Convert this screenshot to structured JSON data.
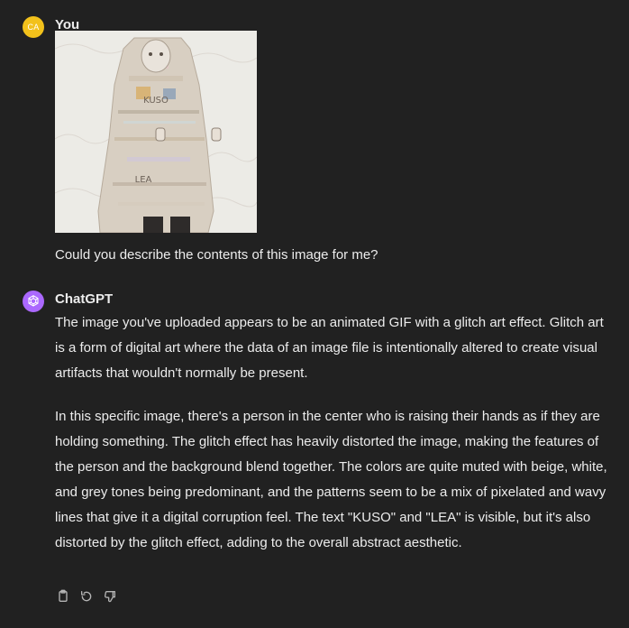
{
  "user_message": {
    "avatar_initials": "CA",
    "author": "You",
    "image_alt": "glitch art image of a person with raised hands",
    "text": "Could you describe the contents of this image for me?"
  },
  "assistant_message": {
    "author": "ChatGPT",
    "paragraphs": [
      "The image you've uploaded appears to be an animated GIF with a glitch art effect. Glitch art is a form of digital art where the data of an image file is intentionally altered to create visual artifacts that wouldn't normally be present.",
      "In this specific image, there's a person in the center who is raising their hands as if they are holding something. The glitch effect has heavily distorted the image, making the features of the person and the background blend together. The colors are quite muted with beige, white, and grey tones being predominant, and the patterns seem to be a mix of pixelated and wavy lines that give it a digital corruption feel. The text \"KUSO\" and \"LEA\" is visible, but it's also distorted by the glitch effect, adding to the overall abstract aesthetic."
    ],
    "actions": [
      "copy-icon",
      "regenerate-icon",
      "thumbs-down-icon"
    ]
  },
  "colors": {
    "background": "#212121",
    "text": "#ececec",
    "user_avatar": "#f2c11b",
    "assistant_avatar": "#ab68ff",
    "icon": "#b4b4b4"
  }
}
